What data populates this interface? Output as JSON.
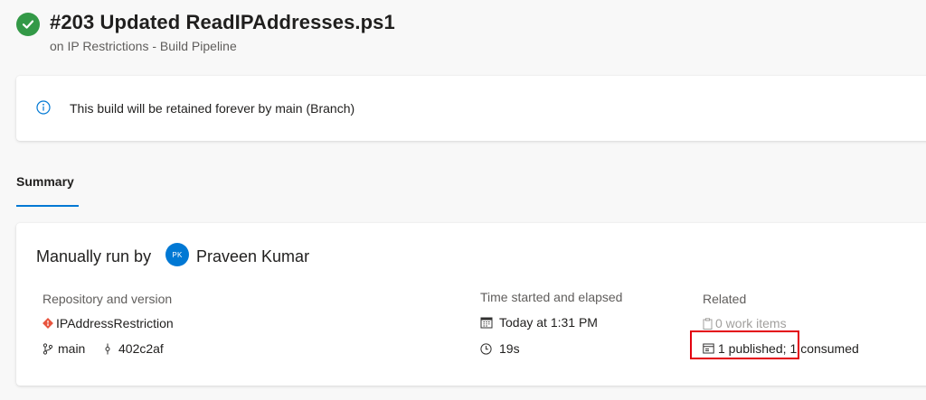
{
  "header": {
    "title": "#203 Updated ReadIPAddresses.ps1",
    "subtitle": "on IP Restrictions - Build Pipeline",
    "status_icon": "check-circle-icon",
    "status_color": "#339947"
  },
  "info_banner": {
    "icon": "info-icon",
    "text": "This build will be retained forever by main (Branch)"
  },
  "tabs": [
    {
      "label": "Summary",
      "selected": true
    }
  ],
  "summary": {
    "run_by_label": "Manually run by",
    "avatar_initials": "PK",
    "user_name": "Praveen Kumar",
    "repository": {
      "heading": "Repository and version",
      "repo_name": "IPAddressRestriction",
      "branch": "main",
      "commit": "402c2af"
    },
    "time": {
      "heading": "Time started and elapsed",
      "started": "Today at 1:31 PM",
      "elapsed": "19s"
    },
    "related": {
      "heading": "Related",
      "work_items": "0 work items",
      "published": "1 published;",
      "consumed": "1 consumed"
    }
  },
  "colors": {
    "accent": "#0078d4",
    "success": "#339947",
    "highlight": "#e3000f",
    "git": "#e8543e"
  }
}
